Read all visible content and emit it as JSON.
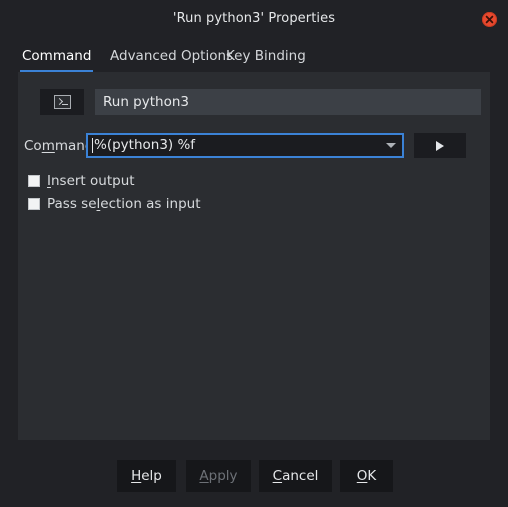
{
  "window": {
    "title": "'Run python3' Properties",
    "close_icon": "close-icon"
  },
  "tabs": [
    {
      "label": "Command",
      "active": true
    },
    {
      "label": "Advanced Options",
      "active": false
    },
    {
      "label": "Key Binding",
      "active": false
    }
  ],
  "command_tab": {
    "icon_button": {
      "icon": "terminal-icon"
    },
    "name_field": {
      "value": "Run python3",
      "placeholder": ""
    },
    "command_label": {
      "text": "Command:",
      "mnemonic": "m"
    },
    "command_combo": {
      "value": "%(python3) %f",
      "placeholder": "",
      "arrow_icon": "chevron-down-icon"
    },
    "run_button": {
      "icon": "play-triangle-icon",
      "label": ""
    },
    "checkboxes": [
      {
        "label": "Insert output",
        "checked": false,
        "mnemonic": "I"
      },
      {
        "label": "Pass selection as input",
        "checked": false,
        "mnemonic": "l"
      }
    ]
  },
  "buttons": [
    {
      "label": "Help",
      "mnemonic": "H",
      "disabled": false
    },
    {
      "label": "Apply",
      "mnemonic": "A",
      "disabled": true
    },
    {
      "label": "Cancel",
      "mnemonic": "C",
      "disabled": false
    },
    {
      "label": "OK",
      "mnemonic": "O",
      "disabled": false
    }
  ],
  "colors": {
    "window_background": "#212226",
    "panel_background": "#2b2d31",
    "accent": "#3b82d6",
    "close_button": "#e8492e",
    "field_background": "#3c4046",
    "input_background": "#1b1c20",
    "button_background": "#16171a",
    "text": "#d7dadd",
    "disabled_text": "#6d7177"
  }
}
